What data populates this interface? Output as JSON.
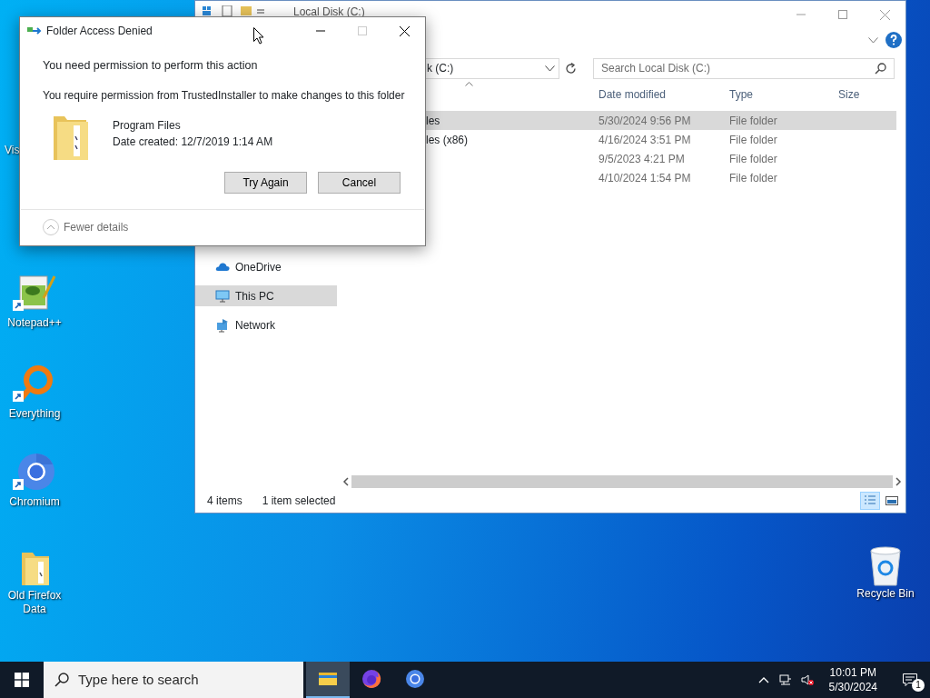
{
  "explorer": {
    "title": "Local Disk (C:)",
    "address": "k (C:)",
    "search": {
      "placeholder": "Search Local Disk (C:)"
    },
    "columns": [
      "Date modified",
      "Type",
      "Size"
    ],
    "rows": [
      {
        "name": "les",
        "date": "5/30/2024 9:56 PM",
        "type": "File folder",
        "selected": true
      },
      {
        "name": "les (x86)",
        "date": "4/16/2024 3:51 PM",
        "type": "File folder",
        "selected": false
      },
      {
        "date": "9/5/2023 4:21 PM",
        "type": "File folder",
        "selected": false
      },
      {
        "date": "4/10/2024 1:54 PM",
        "type": "File folder",
        "selected": false
      }
    ],
    "nav": [
      {
        "label": "OneDrive",
        "kind": "cloud",
        "selected": false
      },
      {
        "label": "This PC",
        "kind": "pc",
        "selected": true
      },
      {
        "label": "Network",
        "kind": "network",
        "selected": false
      }
    ],
    "status": {
      "items": "4 items",
      "selection": "1 item selected"
    },
    "views": [
      {
        "kind": "details",
        "selected": true
      },
      {
        "kind": "tiles",
        "selected": false
      }
    ]
  },
  "dialog": {
    "title": "Folder Access Denied",
    "heading": "You need permission to perform this action",
    "message": "You require permission from TrustedInstaller to make changes to this folder",
    "file": {
      "name": "Program Files",
      "created": "Date created: 12/7/2019 1:14 AM"
    },
    "buttons": [
      "Try Again",
      "Cancel"
    ],
    "details_toggle": "Fewer details"
  },
  "desktop_icons": [
    {
      "label": "Vis",
      "kind": "partial"
    },
    {
      "label": "Notepad++",
      "kind": "notepad"
    },
    {
      "label": "Everything",
      "kind": "everything"
    },
    {
      "label": "Chromium",
      "kind": "chromium"
    },
    {
      "label": "Old Firefox Data",
      "kind": "folder"
    },
    {
      "label": "Recycle Bin",
      "kind": "recycle"
    }
  ],
  "taskbar": {
    "search": {
      "placeholder": "Type here to search"
    },
    "apps": [
      {
        "kind": "explorer",
        "selected": true
      },
      {
        "kind": "firefox",
        "selected": false
      },
      {
        "kind": "chromium",
        "selected": false
      }
    ],
    "time": "10:01 PM",
    "date": "5/30/2024",
    "notifications": "1"
  }
}
